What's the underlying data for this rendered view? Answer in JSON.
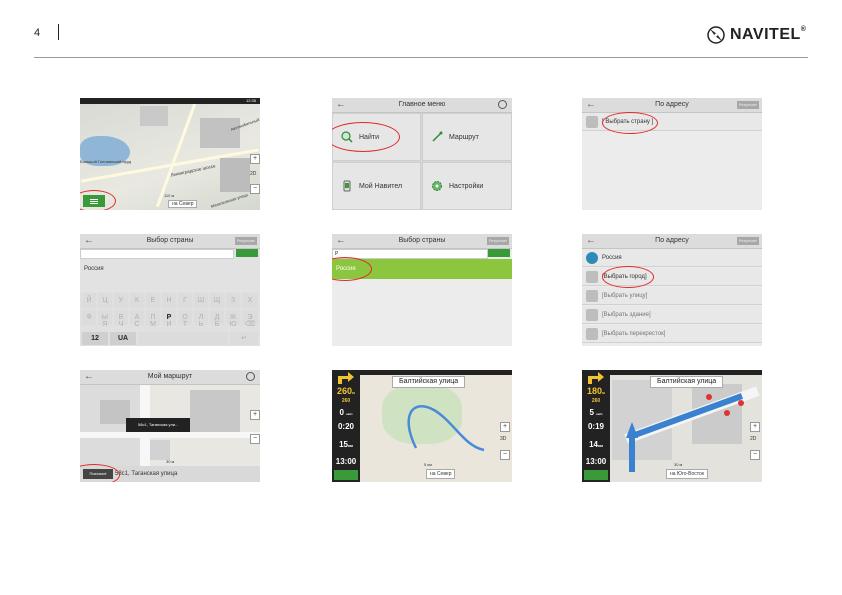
{
  "page": {
    "number": "4",
    "brand": "NAVITEL",
    "brand_mark": "®"
  },
  "s1": {
    "label_lake": "Большой Головинский пруд",
    "label_road1": "Ленинградское шоссе",
    "label_road2": "Михалковская улица",
    "label_road3": "Автомобильный",
    "scale": "110 м",
    "direction": "на Север",
    "zoom_in": "+",
    "zoom_out": "−",
    "mode": "2D",
    "status_time": "12:35"
  },
  "s2": {
    "title": "Главное меню",
    "items": [
      "Найти",
      "Маршрут",
      "Мой Навител",
      "Настройки"
    ]
  },
  "s3": {
    "title": "По адресу",
    "results_btn": "Результат",
    "row": "[ Выбрать страну ]"
  },
  "s4": {
    "title": "Выбор страны",
    "results_btn": "Результат",
    "suggestion": "Россия",
    "kb_rows": [
      [
        "Й",
        "Ц",
        "У",
        "К",
        "Е",
        "Н",
        "Г",
        "Ш",
        "Щ",
        "З",
        "Х"
      ],
      [
        "Ф",
        "Ы",
        "В",
        "А",
        "П",
        "Р",
        "О",
        "Л",
        "Д",
        "Ж",
        "Э"
      ],
      [
        "Я",
        "Ч",
        "С",
        "М",
        "И",
        "Т",
        "Ь",
        "Б",
        "Ю",
        "⌫"
      ]
    ],
    "key_num": "12",
    "key_lang": "UA",
    "key_enter": "↵"
  },
  "s5": {
    "title": "Выбор страны",
    "results_btn": "Результат",
    "query": "Р",
    "selected": "Россия"
  },
  "s6": {
    "title": "По адресу",
    "results_btn": "Результат",
    "rows": [
      "Россия",
      "[Выбрать город]",
      "[Выбрать улицу]",
      "[Выбрать здание]",
      "[Выбрать перекресток]"
    ]
  },
  "s7": {
    "title": "Мой маршрут",
    "popup": "58с1, Таганская ули...",
    "bottom_btn": "Поехали!",
    "address": "58с1, Таганская улица",
    "scale": "30 м",
    "zoom_in": "+",
    "zoom_out": "−"
  },
  "s8": {
    "street": "Балтийская улица",
    "dist_top": "260",
    "unit_top": "м",
    "dist_small": "260",
    "speed": "0",
    "speed_unit": "км/ч",
    "time_left": "0:20",
    "remaining": "15",
    "remaining_unit": "км",
    "clock": "13:00",
    "direction": "на Север",
    "scale": "5 км",
    "zoom_in": "+",
    "zoom_out": "−",
    "mode": "3D"
  },
  "s9": {
    "street": "Балтийская улица",
    "dist_top": "180",
    "unit_top": "м",
    "dist_small": "260",
    "speed": "5",
    "speed_unit": "км/ч",
    "time_left": "0:19",
    "remaining": "14",
    "remaining_unit": "км",
    "clock": "13:00",
    "direction": "на Юго-Восток",
    "scale": "30 м",
    "zoom_in": "+",
    "zoom_out": "−",
    "mode": "2D"
  }
}
